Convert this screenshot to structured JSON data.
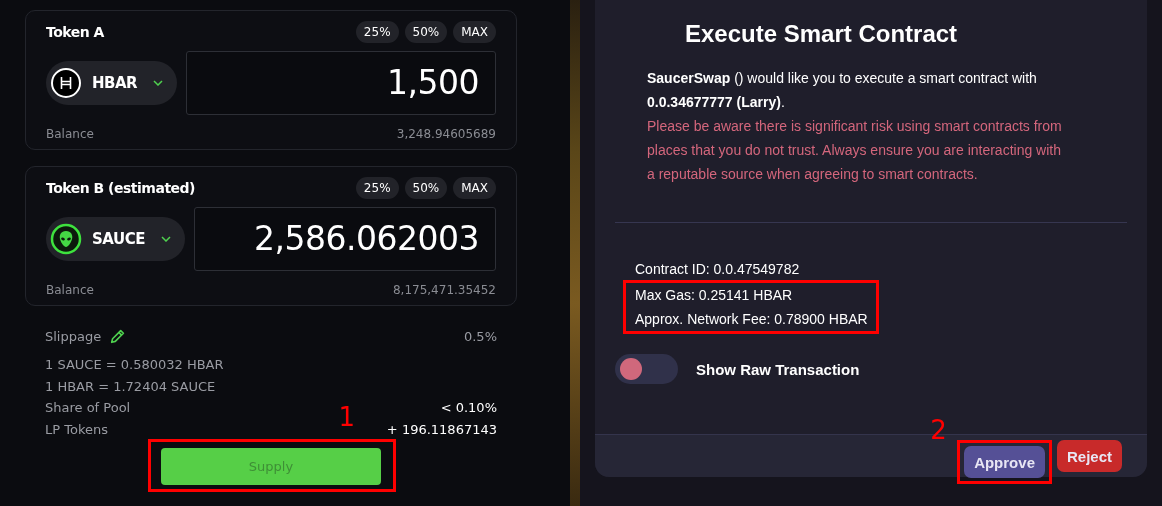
{
  "tokens": [
    {
      "label": "Token A",
      "presets": [
        "25%",
        "50%",
        "MAX"
      ],
      "kind": "hbar",
      "symbol": "HBAR",
      "amount": "1,500",
      "balance_label": "Balance",
      "balance": "3,248.94605689"
    },
    {
      "label": "Token B (estimated)",
      "presets": [
        "25%",
        "50%",
        "MAX"
      ],
      "kind": "sauce",
      "symbol": "SAUCE",
      "amount": "2,586.062003",
      "balance_label": "Balance",
      "balance": "8,175,471.35452"
    }
  ],
  "slippage": {
    "label": "Slippage",
    "value": "0.5%"
  },
  "rates": [
    "1 SAUCE = 0.580032 HBAR",
    "1 HBAR = 1.72404 SAUCE"
  ],
  "details": [
    {
      "label": "Share of Pool",
      "value": "< 0.10%"
    },
    {
      "label": "LP Tokens",
      "value": "+ 196.11867143"
    }
  ],
  "supply": {
    "label": "Supply",
    "marker": "1"
  },
  "dialog": {
    "title": "Execute Smart Contract",
    "message": "**SaucerSwap** () would like you to execute a smart contract with **0.0.34677777 (Larry)**.",
    "warning": "Please be aware there is significant risk using smart contracts from places that you do not trust. Always ensure you are interacting with a reputable source when agreeing to smart contracts.",
    "contract_id": "Contract ID: 0.0.47549782",
    "fees": [
      "Max Gas: 0.25141 HBAR",
      "Approx. Network Fee: 0.78900 HBAR"
    ],
    "toggle": {
      "label": "Show Raw Transaction",
      "on": false
    },
    "buttons": [
      {
        "label": "Approve",
        "kind": "primary",
        "marker": "2"
      },
      {
        "label": "Reject",
        "kind": "danger"
      }
    ]
  }
}
